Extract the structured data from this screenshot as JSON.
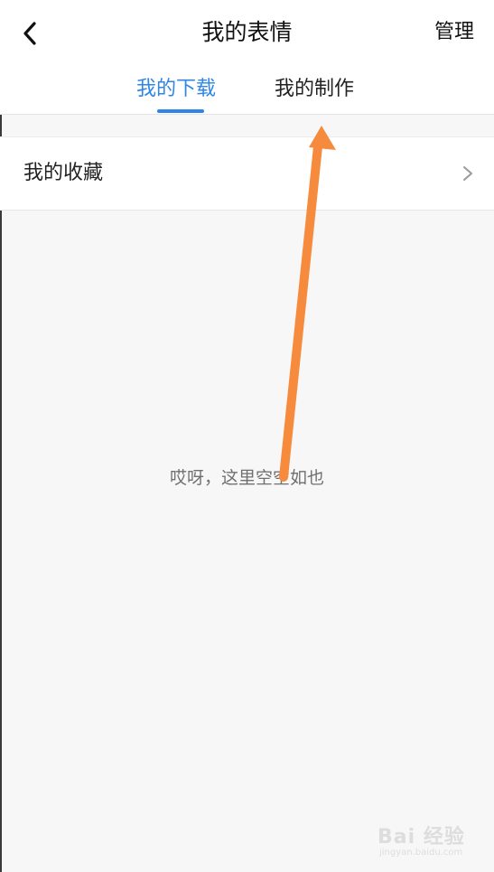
{
  "header": {
    "title": "我的表情",
    "manage_label": "管理",
    "back_icon": "chevron-left-icon"
  },
  "tabs": [
    {
      "label": "我的下载",
      "active": true
    },
    {
      "label": "我的制作",
      "active": false
    }
  ],
  "favorites_row": {
    "label": "我的收藏",
    "icon": "chevron-right-icon"
  },
  "empty_state": {
    "message": "哎呀，这里空空如也"
  },
  "annotation": {
    "arrow_color": "#f68b3e"
  },
  "watermark": {
    "brand": "Bai 经验",
    "url": "jingyan.baidu.com"
  },
  "colors": {
    "accent": "#2f86e6",
    "background": "#f7f7f7",
    "surface": "#ffffff"
  }
}
